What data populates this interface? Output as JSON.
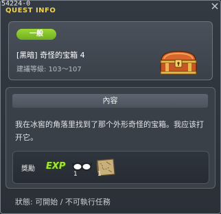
{
  "window": {
    "id": "54224-0",
    "title": "QUEST INFO"
  },
  "quest": {
    "category_badge": "一般",
    "name": "[黑暗] 奇怪的宝箱 4",
    "level_label": "建議等級: 103～107"
  },
  "content": {
    "header": "內容",
    "description": "我在冰窖的角落里找到了那个外形奇怪的宝箱。我应该打开它。"
  },
  "rewards": {
    "label": "獎勵",
    "exp_text": "EXP",
    "items": [
      {
        "icon": "glasses-icon",
        "quantity": "1"
      },
      {
        "icon": "map-scroll-icon",
        "quantity": "1"
      }
    ]
  },
  "status": "狀態: 可開始 / 不可執行任務",
  "colors": {
    "title": "#f2d24a",
    "badge": "#8cc63f",
    "exp": "#a7e53a"
  }
}
